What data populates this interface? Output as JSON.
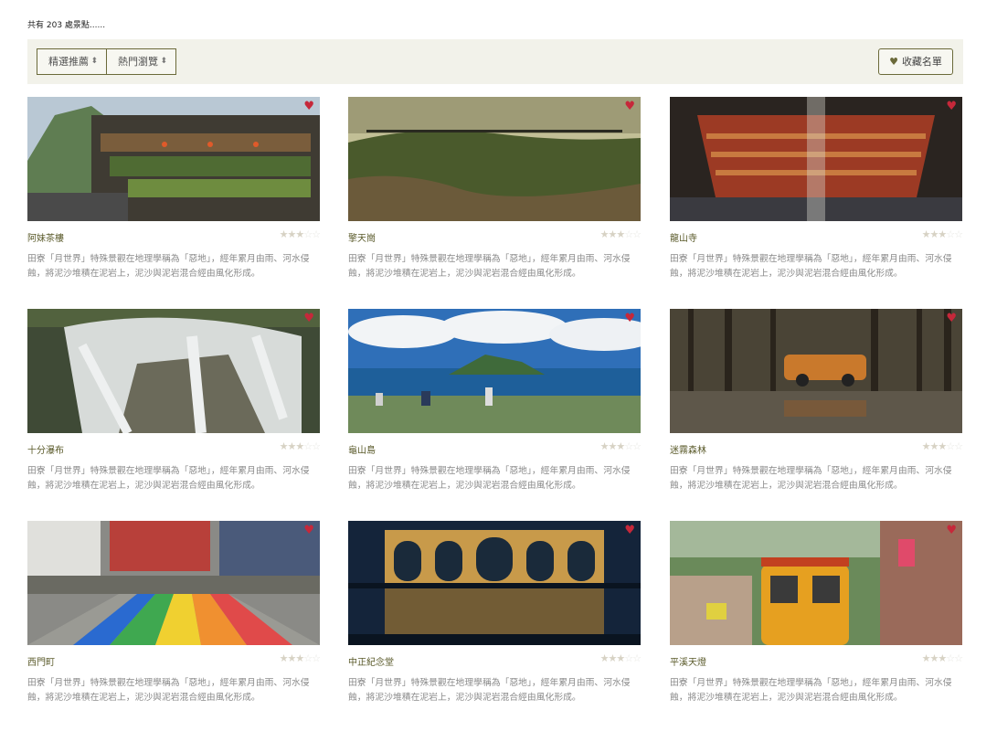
{
  "header": {
    "count_text": "共有 203 處景點......"
  },
  "toolbar": {
    "select_featured": "精選推薦",
    "select_popular": "熱門瀏覽",
    "favorites_label": "收藏名單"
  },
  "colors": {
    "accent": "#6b6a3a",
    "heart": "#c6283a",
    "toolbar_bg": "#f2f2ea"
  },
  "cards": [
    {
      "title": "阿妹茶樓",
      "rating": 3,
      "max_rating": 5,
      "favorited": true,
      "desc": "田寮「月世界」特殊景觀在地理學稱為「惡地」，經年累月由雨、河水侵蝕，將泥沙堆積在泥岩上，泥沙與泥岩混合經由風化形成。"
    },
    {
      "title": "擎天崗",
      "rating": 3,
      "max_rating": 5,
      "favorited": true,
      "desc": "田寮「月世界」特殊景觀在地理學稱為「惡地」，經年累月由雨、河水侵蝕，將泥沙堆積在泥岩上，泥沙與泥岩混合經由風化形成。"
    },
    {
      "title": "龍山寺",
      "rating": 3,
      "max_rating": 5,
      "favorited": true,
      "desc": "田寮「月世界」特殊景觀在地理學稱為「惡地」，經年累月由雨、河水侵蝕，將泥沙堆積在泥岩上，泥沙與泥岩混合經由風化形成。"
    },
    {
      "title": "十分瀑布",
      "rating": 3,
      "max_rating": 5,
      "favorited": true,
      "desc": "田寮「月世界」特殊景觀在地理學稱為「惡地」，經年累月由雨、河水侵蝕，將泥沙堆積在泥岩上，泥沙與泥岩混合經由風化形成。"
    },
    {
      "title": "龜山島",
      "rating": 3,
      "max_rating": 5,
      "favorited": true,
      "desc": "田寮「月世界」特殊景觀在地理學稱為「惡地」，經年累月由雨、河水侵蝕，將泥沙堆積在泥岩上，泥沙與泥岩混合經由風化形成。"
    },
    {
      "title": "迷霧森林",
      "rating": 3,
      "max_rating": 5,
      "favorited": true,
      "desc": "田寮「月世界」特殊景觀在地理學稱為「惡地」，經年累月由雨、河水侵蝕，將泥沙堆積在泥岩上，泥沙與泥岩混合經由風化形成。"
    },
    {
      "title": "西門町",
      "rating": 3,
      "max_rating": 5,
      "favorited": true,
      "desc": "田寮「月世界」特殊景觀在地理學稱為「惡地」，經年累月由雨、河水侵蝕，將泥沙堆積在泥岩上，泥沙與泥岩混合經由風化形成。"
    },
    {
      "title": "中正紀念堂",
      "rating": 3,
      "max_rating": 5,
      "favorited": true,
      "desc": "田寮「月世界」特殊景觀在地理學稱為「惡地」，經年累月由雨、河水侵蝕，將泥沙堆積在泥岩上，泥沙與泥岩混合經由風化形成。"
    },
    {
      "title": "平溪天燈",
      "rating": 3,
      "max_rating": 5,
      "favorited": true,
      "desc": "田寮「月世界」特殊景觀在地理學稱為「惡地」，經年累月由雨、河水侵蝕，將泥沙堆積在泥岩上，泥沙與泥岩混合經由風化形成。"
    }
  ]
}
